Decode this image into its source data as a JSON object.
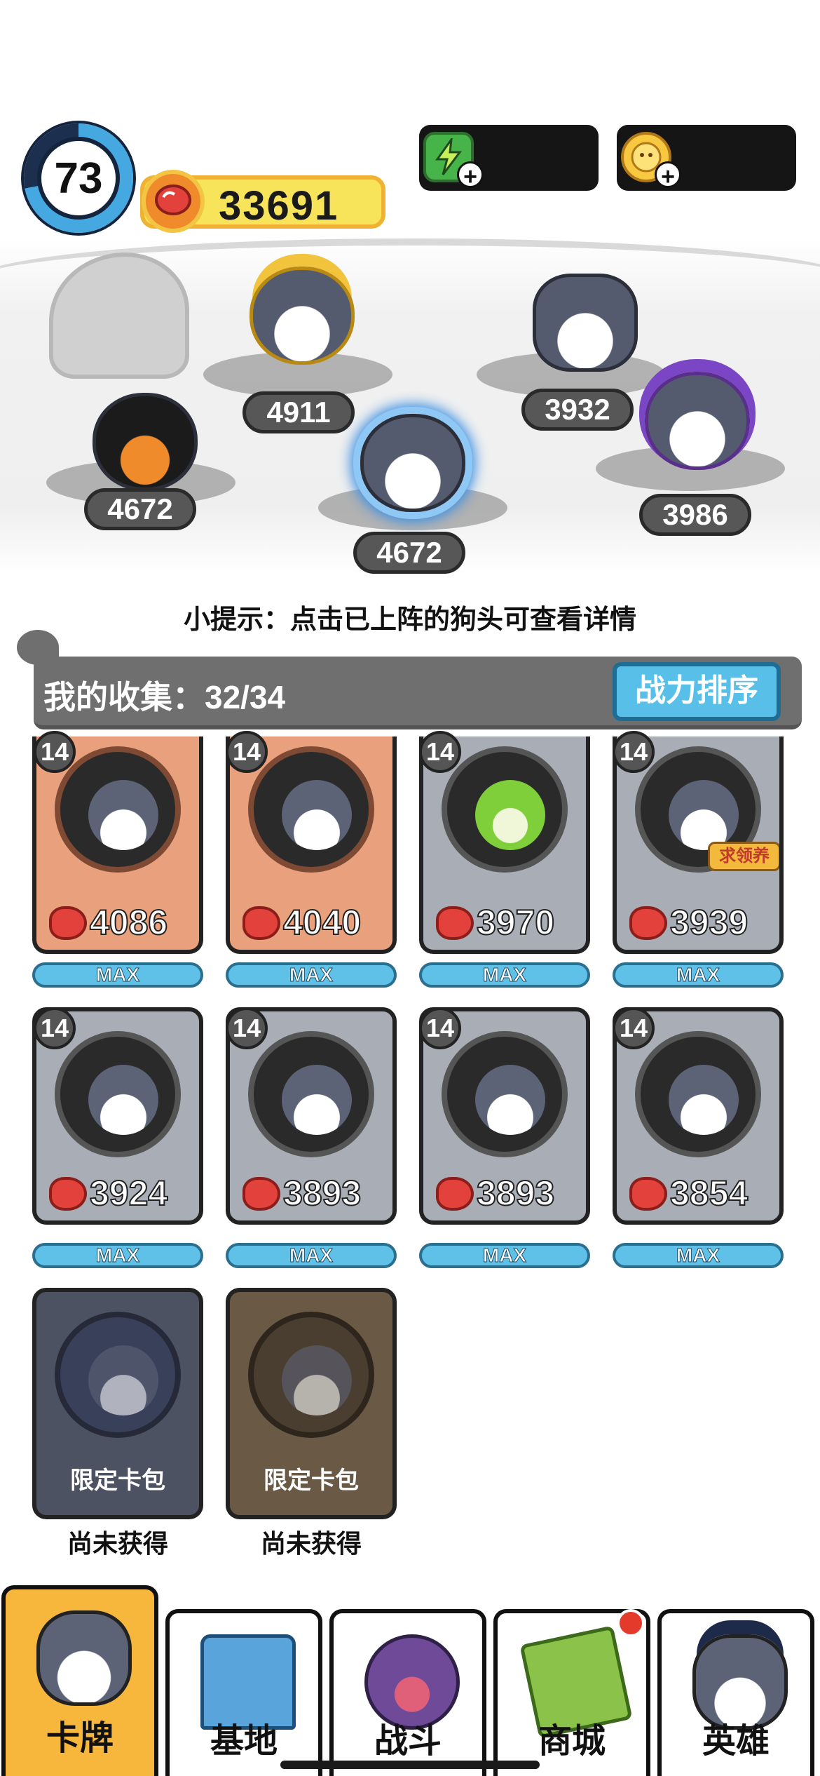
{
  "hud": {
    "level": "73",
    "level_progress_fraction": 0.72,
    "total_power": "33691",
    "energy_icon": "lightning-icon",
    "coin_icon": "coin-icon"
  },
  "lineup": [
    {
      "name": "fire-bomb-dog",
      "power": "4672"
    },
    {
      "name": "golden-helmet-dog",
      "power": "4911"
    },
    {
      "name": "bubble-shield-dog",
      "power": "4672"
    },
    {
      "name": "laptop-dog",
      "power": "3932"
    },
    {
      "name": "wizard-dog",
      "power": "3986"
    }
  ],
  "hint": "小提示：点击已上阵的狗头可查看详情",
  "collection": {
    "label": "我的收集：32/34",
    "sort_button": "战力排序"
  },
  "cards": [
    {
      "level": "14",
      "power": "4086",
      "max": "MAX",
      "tier": "copper"
    },
    {
      "level": "14",
      "power": "4040",
      "max": "MAX",
      "tier": "copper"
    },
    {
      "level": "14",
      "power": "3970",
      "max": "MAX",
      "tier": "silver"
    },
    {
      "level": "14",
      "power": "3939",
      "max": "MAX",
      "tier": "silver"
    },
    {
      "level": "14",
      "power": "3924",
      "max": "MAX",
      "tier": "silver"
    },
    {
      "level": "14",
      "power": "3893",
      "max": "MAX",
      "tier": "silver"
    },
    {
      "level": "14",
      "power": "3893",
      "max": "MAX",
      "tier": "silver"
    },
    {
      "level": "14",
      "power": "3854",
      "max": "MAX",
      "tier": "silver"
    }
  ],
  "card_badge_3": "求领养",
  "locked_cards": [
    {
      "label": "限定卡包",
      "status": "尚未获得"
    },
    {
      "label": "限定卡包",
      "status": "尚未获得"
    }
  ],
  "nav": [
    {
      "label": "卡牌",
      "icon": "dog-face-icon",
      "active": true
    },
    {
      "label": "基地",
      "icon": "castle-icon"
    },
    {
      "label": "战斗",
      "icon": "paw-icon"
    },
    {
      "label": "商城",
      "icon": "money-icon",
      "badge": true
    },
    {
      "label": "英雄",
      "icon": "hero-dog-icon"
    }
  ],
  "colors": {
    "accent_blue": "#58bfe8",
    "active_tab": "#f6b73c",
    "power_pill": "#f7e45a",
    "copper_card": "#e9a07c",
    "silver_card": "#a9aeb6"
  }
}
